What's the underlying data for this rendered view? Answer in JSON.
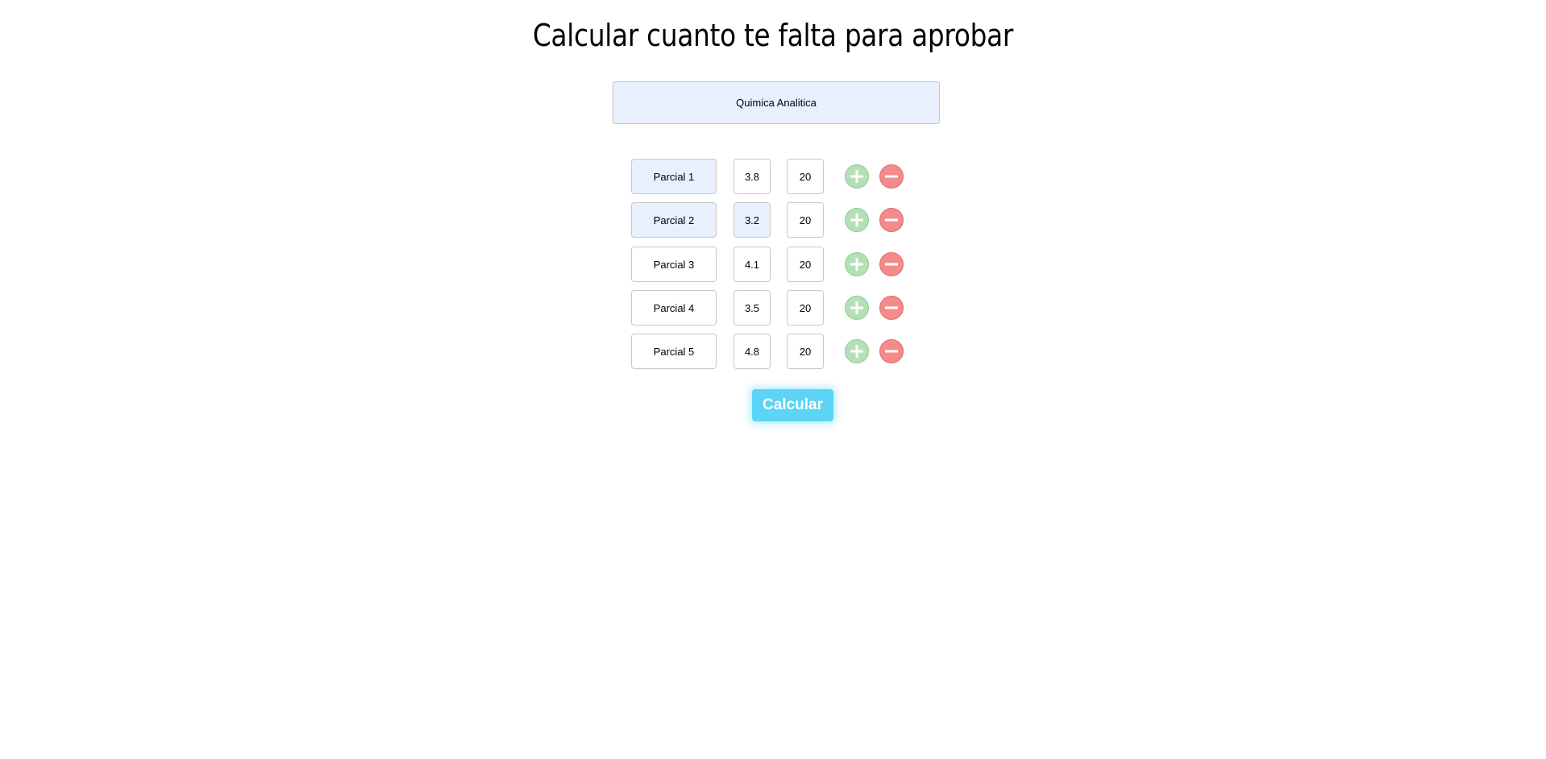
{
  "header": {
    "title": "Calcular cuanto te falta para aprobar"
  },
  "subject": {
    "value": "Quimica Analitica"
  },
  "rows": [
    {
      "name": "Parcial 1",
      "grade": "3.8",
      "weight": "20"
    },
    {
      "name": "Parcial 2",
      "grade": "3.2",
      "weight": "20"
    },
    {
      "name": "Parcial 3",
      "grade": "4.1",
      "weight": "20"
    },
    {
      "name": "Parcial 4",
      "grade": "3.5",
      "weight": "20"
    },
    {
      "name": "Parcial 5",
      "grade": "4.8",
      "weight": "20"
    }
  ],
  "actions": {
    "calculate_label": "Calcular",
    "add_icon": "plus-circle-icon",
    "remove_icon": "minus-circle-icon"
  },
  "colors": {
    "add_green": "#b4e0b5",
    "remove_red": "#f48b8b",
    "calculate_cyan": "#5cd4f6",
    "autofill_blue": "#e8f0fe"
  }
}
